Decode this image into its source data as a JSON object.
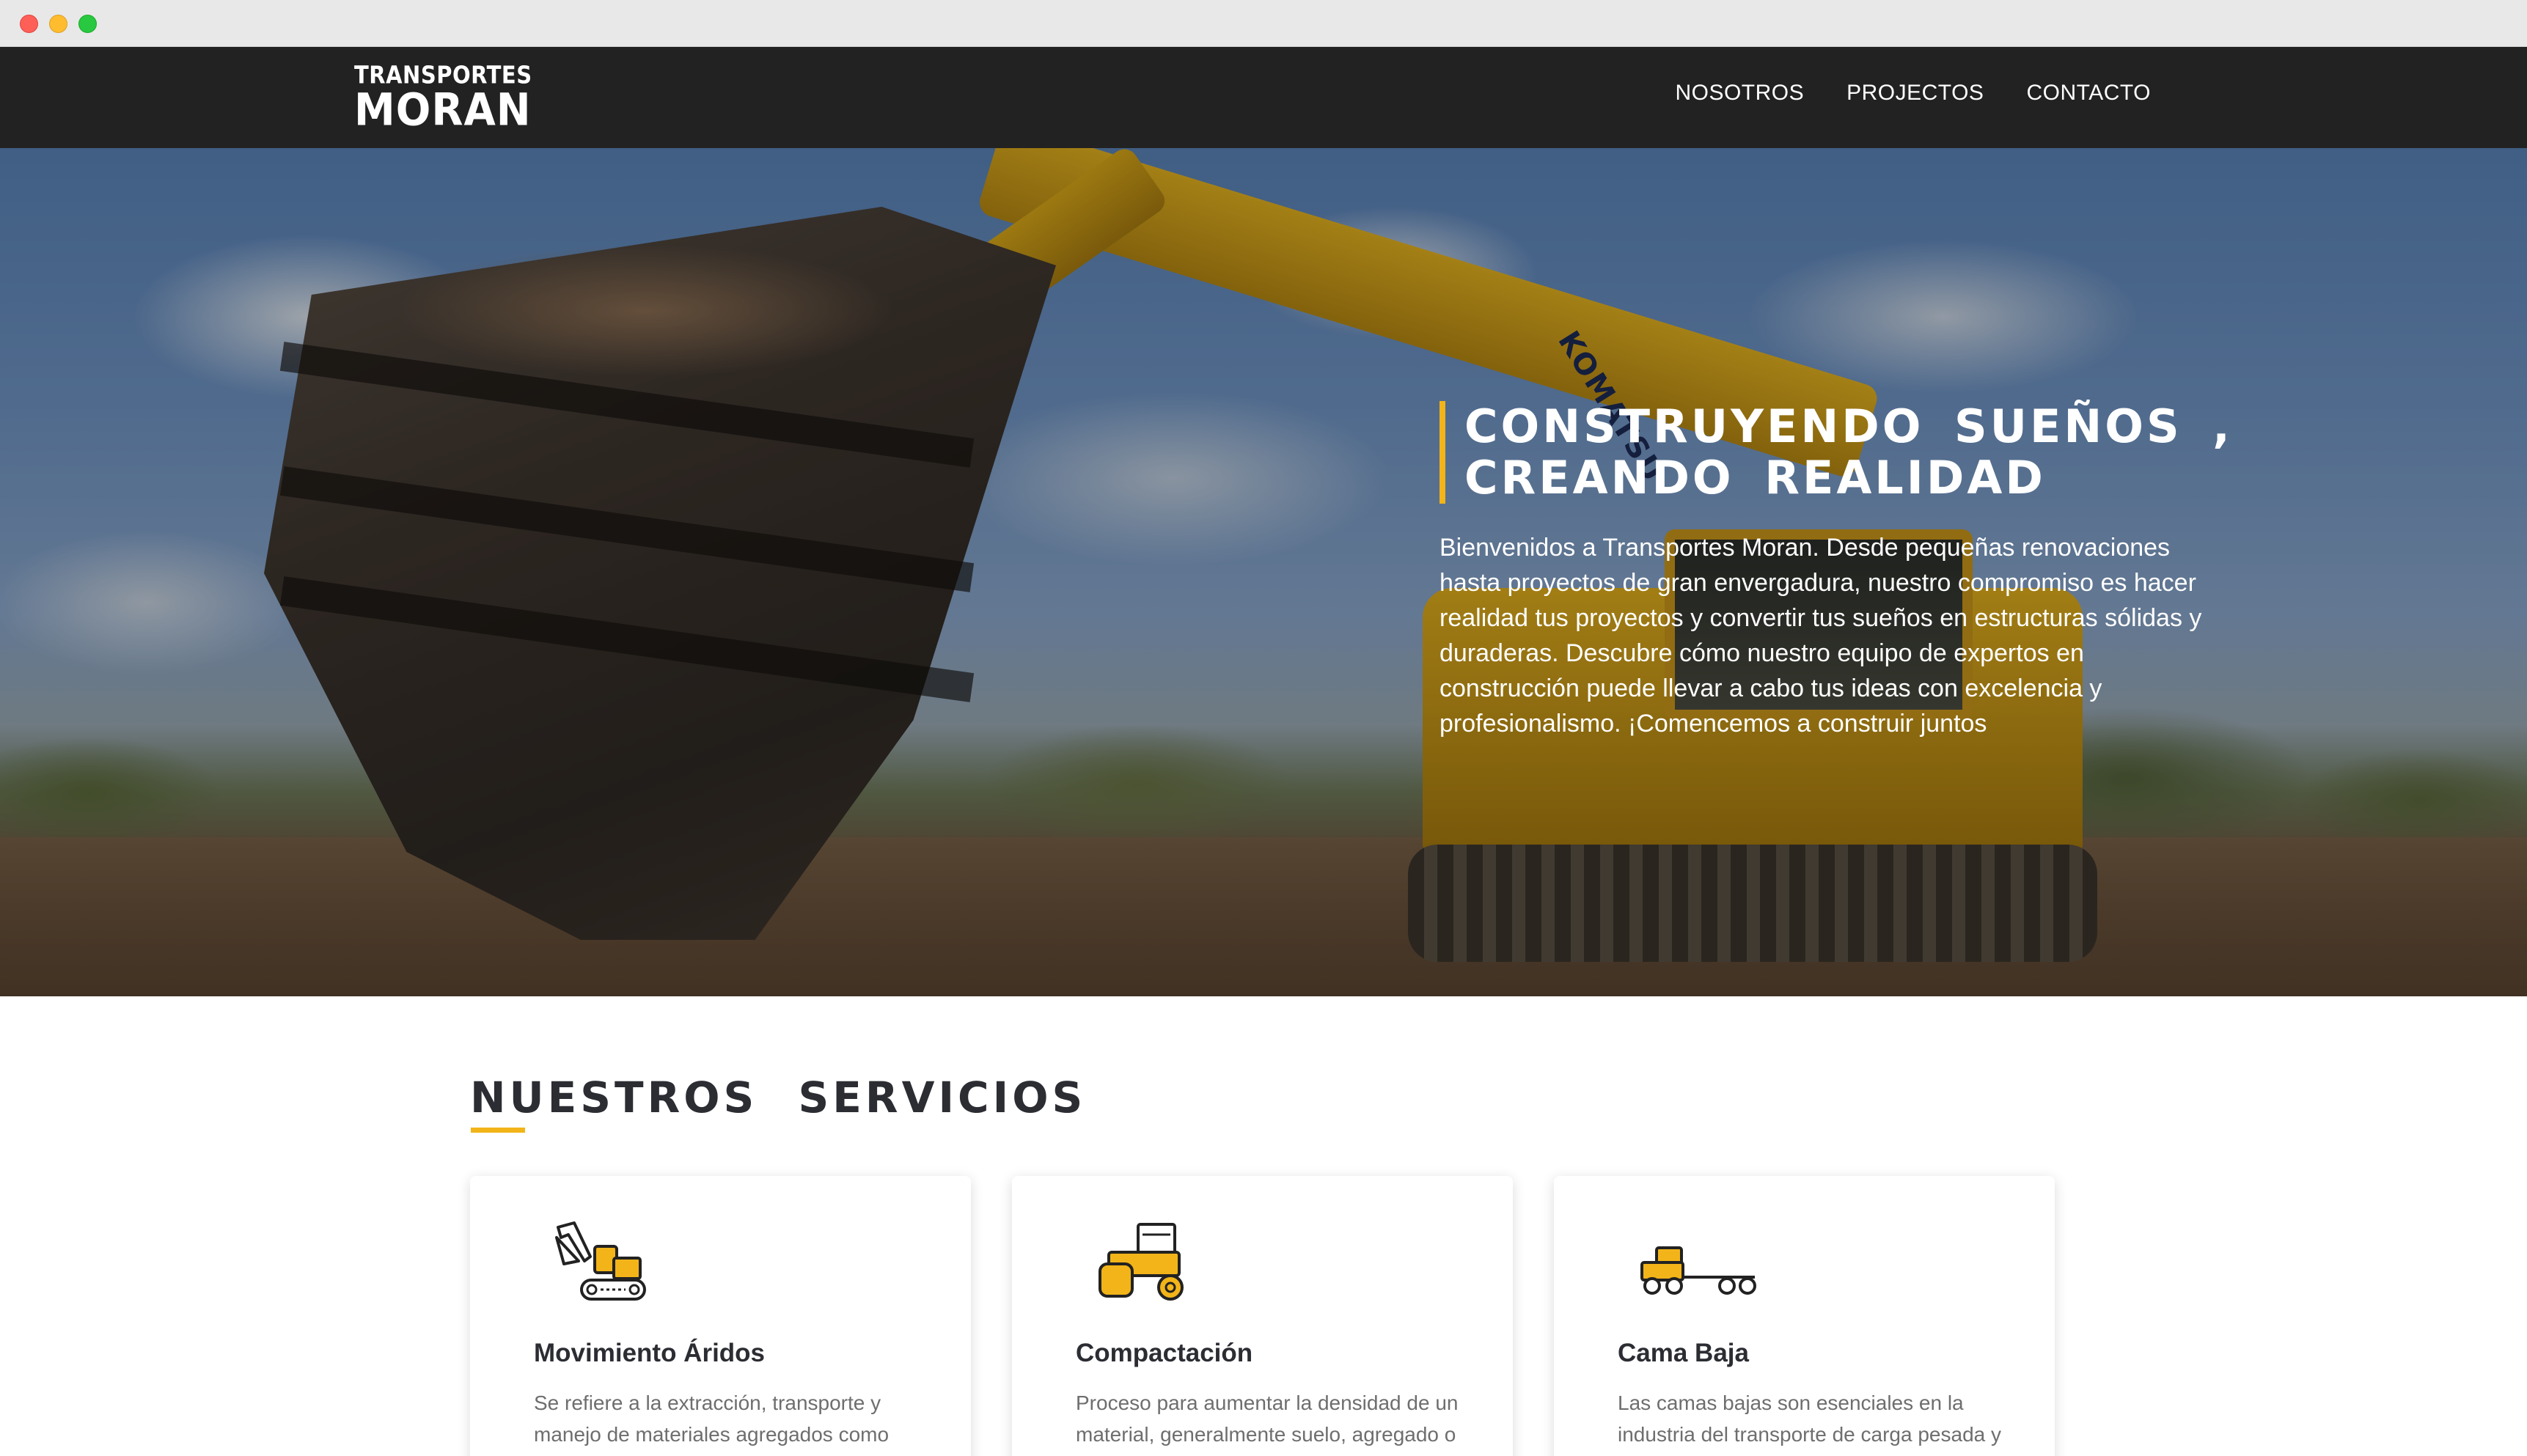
{
  "brand": {
    "logo_top": "TRANSPORTES",
    "logo_bottom": "MORAN"
  },
  "nav": {
    "items": [
      {
        "label": "NOSOTROS"
      },
      {
        "label": "PROJECTOS"
      },
      {
        "label": "CONTACTO"
      }
    ]
  },
  "hero": {
    "title_line1": "CONSTRUYENDO SUEÑOS ,",
    "title_line2": "CREANDO REALIDAD",
    "body": "Bienvenidos a Transportes Moran. Desde pequeñas renovaciones hasta proyectos de gran envergadura, nuestro compromiso es hacer realidad tus proyectos y convertir tus sueños en estructuras sólidas y duraderas. Descubre cómo nuestro equipo de expertos en construcción puede llevar a cabo tus ideas con excelencia y profesionalismo. ¡Comencemos a construir juntos",
    "machine_brand": "KOMATSU"
  },
  "services": {
    "title": "NUESTROS SERVICIOS",
    "cards": [
      {
        "icon": "excavator-icon",
        "title": "Movimiento Áridos",
        "text": "Se refiere a la extracción, transporte y manejo de materiales agregados como"
      },
      {
        "icon": "road-roller-icon",
        "title": "Compactación",
        "text": "Proceso para aumentar la densidad de un material, generalmente suelo, agregado o"
      },
      {
        "icon": "lowboy-truck-icon",
        "title": "Cama Baja",
        "text": "Las camas bajas son esenciales en la industria del transporte de carga pesada y"
      }
    ]
  },
  "colors": {
    "accent": "#f2b418",
    "navbar": "#222222",
    "heading": "#2b2d33",
    "body_text": "#6e6e6e"
  }
}
